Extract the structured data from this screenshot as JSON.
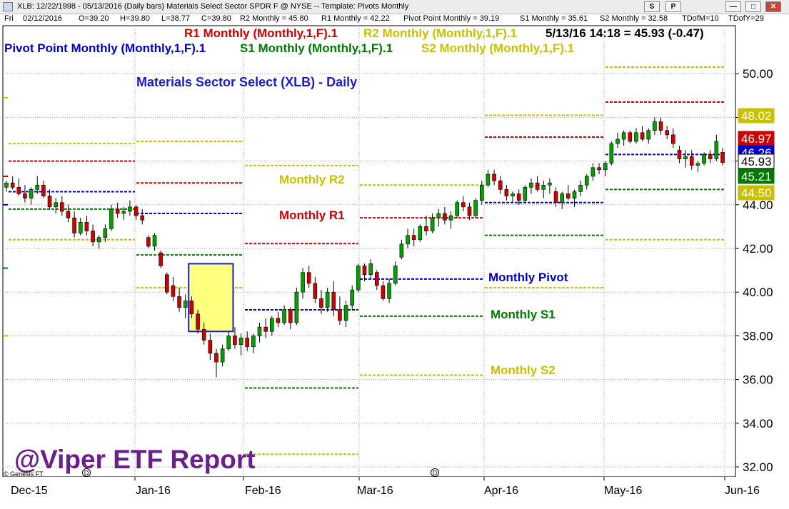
{
  "window": {
    "title": "XLB: 12/22/1998 - 05/13/2016  (Daily bars)   Materials Select Sector SPDR F @ NYSE  --  Template: Pivots Monthly",
    "buttons": {
      "s": "S",
      "p": "P",
      "minimize": "—",
      "maximize": "□",
      "close": "✕"
    }
  },
  "info_bar": {
    "day": "Fri",
    "date": "02/12/2016",
    "open": "O=39.20",
    "high": "H=39.80",
    "low": "L=38.77",
    "close": "C=39.80",
    "r2": "R2 Monthly = 45.80",
    "r1": "R1 Monthly = 42.22",
    "pp": "Pivot Point Monthly = 39.19",
    "s1": "S1 Monthly = 35.61",
    "s2": "S2 Monthly = 32.58",
    "tdom": "TDofM=10",
    "tdoy": "TDofY=29"
  },
  "chart_data": {
    "type": "candlestick",
    "title": "Materials Sector Select (XLB) - Daily",
    "last_quote": "5/13/16 14:18 = 45.93 (-0.47)",
    "watermark": "@Viper ETF Report",
    "copyright": "© Genesis FT",
    "ylim": [
      31.5,
      52.0
    ],
    "y_ticks": [
      32,
      34,
      36,
      38,
      40,
      42,
      44,
      46,
      48,
      50
    ],
    "y_tick_labels": [
      "32.00",
      "34.00",
      "36.00",
      "38.00",
      "40.00",
      "42.00",
      "44.00",
      "46.00",
      "48.00",
      "50.00"
    ],
    "x_ticks": [
      "Dec-15",
      "Jan-16",
      "Feb-16",
      "Mar-16",
      "Apr-16",
      "May-16",
      "Jun-16"
    ],
    "legend": [
      {
        "text": "R1 Monthly (Monthly,1,F).1",
        "color": "#cc0000"
      },
      {
        "text": "R2 Monthly (Monthly,1,F).1",
        "color": "#c8c000"
      },
      {
        "text": "Pivot Point Monthly (Monthly,1,F).1",
        "color": "#0000cc"
      },
      {
        "text": "S1 Monthly (Monthly,1,F).1",
        "color": "#007a00"
      },
      {
        "text": "S2 Monthly (Monthly,1,F).1",
        "color": "#c8c000"
      }
    ],
    "pivot_levels": [
      {
        "month": "Dec-15",
        "r2": 46.8,
        "r1": 46.0,
        "pp": 44.6,
        "s1": 43.8,
        "s2": 42.4
      },
      {
        "month": "Jan-16",
        "r2": 46.9,
        "r1": 45.0,
        "pp": 43.6,
        "s1": 41.7,
        "s2": 40.2
      },
      {
        "month": "Feb-16",
        "r2": 45.8,
        "r1": 42.22,
        "pp": 39.19,
        "s1": 35.61,
        "s2": 32.58
      },
      {
        "month": "Mar-16",
        "r2": 44.9,
        "r1": 43.4,
        "pp": 40.6,
        "s1": 38.9,
        "s2": 36.2
      },
      {
        "month": "Apr-16",
        "r2": 48.1,
        "r1": 47.1,
        "pp": 44.1,
        "s1": 42.6,
        "s2": 40.2
      },
      {
        "month": "May-16",
        "r2": 50.3,
        "r1": 48.7,
        "pp": 46.3,
        "s1": 44.7,
        "s2": 42.4
      }
    ],
    "annotations": [
      {
        "text": "Monthly R2",
        "color": "#c8c000"
      },
      {
        "text": "Monthly R1",
        "color": "#cc0000"
      },
      {
        "text": "Monthly Pivot",
        "color": "#0000cc"
      },
      {
        "text": "Monthly S1",
        "color": "#007a00"
      },
      {
        "text": "Monthly S2",
        "color": "#c8c000"
      }
    ],
    "price_tags": [
      {
        "text": "48.02",
        "value": 48.02,
        "bg": "#c8c000",
        "fg": "#ffffff"
      },
      {
        "text": "46.97",
        "value": 46.97,
        "bg": "#cc0000",
        "fg": "#ffffff"
      },
      {
        "text": "46.26",
        "value": 46.26,
        "bg": "#0000cc",
        "fg": "#ffffff"
      },
      {
        "text": "45.93",
        "value": 45.93,
        "bg": "#ffffff",
        "fg": "#000000"
      },
      {
        "text": "45.21",
        "value": 45.21,
        "bg": "#007a00",
        "fg": "#ffffff"
      },
      {
        "text": "44.50",
        "value": 44.5,
        "bg": "#c8c000",
        "fg": "#ffffff"
      }
    ],
    "highlight_range": {
      "from_bar": 38,
      "to_bar": 45,
      "low": 38.2,
      "high": 41.3
    },
    "candles": [
      [
        44.8,
        45.1,
        44.6,
        45.0
      ],
      [
        45.0,
        45.3,
        44.7,
        44.8
      ],
      [
        44.8,
        45.2,
        44.4,
        44.5
      ],
      [
        44.5,
        44.9,
        44.1,
        44.3
      ],
      [
        44.3,
        44.8,
        44.0,
        44.7
      ],
      [
        44.7,
        45.3,
        44.5,
        44.9
      ],
      [
        44.9,
        45.1,
        44.3,
        44.4
      ],
      [
        44.4,
        44.7,
        43.8,
        43.9
      ],
      [
        43.9,
        44.3,
        43.6,
        44.1
      ],
      [
        44.1,
        44.4,
        43.5,
        43.7
      ],
      [
        43.7,
        44.0,
        43.2,
        43.4
      ],
      [
        43.4,
        43.7,
        42.5,
        42.7
      ],
      [
        42.7,
        43.4,
        42.6,
        43.2
      ],
      [
        43.2,
        43.5,
        42.6,
        42.8
      ],
      [
        42.8,
        43.1,
        42.1,
        42.3
      ],
      [
        42.3,
        42.6,
        42.0,
        42.5
      ],
      [
        42.5,
        43.1,
        42.3,
        42.9
      ],
      [
        42.9,
        44.0,
        42.8,
        43.8
      ],
      [
        43.8,
        44.1,
        43.4,
        43.6
      ],
      [
        43.6,
        43.9,
        43.3,
        43.7
      ],
      [
        43.7,
        44.2,
        43.5,
        43.9
      ],
      [
        43.9,
        44.0,
        43.3,
        43.5
      ],
      [
        43.5,
        43.8,
        43.1,
        43.3
      ],
      [
        42.5,
        42.6,
        42.0,
        42.1
      ],
      [
        42.1,
        42.7,
        41.9,
        42.6
      ],
      [
        41.8,
        41.9,
        41.1,
        41.2
      ],
      [
        40.8,
        40.9,
        39.9,
        40.0
      ],
      [
        40.3,
        40.7,
        39.6,
        39.8
      ],
      [
        39.8,
        40.2,
        39.1,
        39.3
      ],
      [
        39.3,
        39.9,
        38.8,
        39.6
      ],
      [
        39.6,
        39.8,
        38.8,
        39.0
      ],
      [
        39.0,
        39.2,
        38.1,
        38.3
      ],
      [
        38.3,
        38.6,
        37.6,
        37.8
      ],
      [
        37.8,
        38.1,
        36.9,
        37.2
      ],
      [
        37.2,
        37.4,
        36.1,
        36.8
      ],
      [
        36.8,
        37.6,
        36.6,
        37.4
      ],
      [
        37.4,
        38.2,
        37.3,
        38.0
      ],
      [
        38.0,
        38.4,
        37.4,
        37.6
      ],
      [
        37.6,
        38.1,
        37.1,
        37.9
      ],
      [
        37.9,
        38.2,
        37.3,
        37.5
      ],
      [
        37.5,
        38.1,
        37.2,
        38.0
      ],
      [
        38.0,
        38.6,
        37.7,
        38.4
      ],
      [
        38.4,
        38.8,
        37.9,
        38.2
      ],
      [
        38.2,
        38.9,
        38.0,
        38.8
      ],
      [
        38.8,
        39.1,
        38.4,
        38.6
      ],
      [
        38.6,
        39.4,
        38.5,
        39.2
      ],
      [
        39.2,
        39.3,
        38.3,
        38.6
      ],
      [
        38.6,
        40.2,
        38.5,
        40.0
      ],
      [
        40.0,
        41.1,
        39.7,
        40.9
      ],
      [
        40.9,
        41.2,
        40.2,
        40.4
      ],
      [
        40.4,
        40.7,
        39.5,
        39.7
      ],
      [
        39.7,
        40.1,
        39.0,
        39.3
      ],
      [
        39.3,
        40.2,
        39.1,
        40.0
      ],
      [
        40.0,
        40.5,
        38.9,
        39.2
      ],
      [
        39.2,
        39.8,
        38.5,
        38.7
      ],
      [
        38.7,
        39.6,
        38.4,
        39.4
      ],
      [
        39.4,
        40.3,
        39.2,
        40.1
      ],
      [
        40.1,
        41.3,
        40.0,
        41.2
      ],
      [
        41.2,
        41.3,
        40.5,
        40.8
      ],
      [
        40.8,
        41.5,
        40.6,
        41.3
      ],
      [
        40.9,
        41.0,
        40.1,
        40.3
      ],
      [
        40.3,
        40.5,
        39.6,
        39.7
      ],
      [
        39.7,
        40.6,
        39.5,
        40.4
      ],
      [
        40.4,
        41.4,
        40.3,
        41.2
      ],
      [
        41.6,
        42.4,
        41.5,
        42.2
      ],
      [
        42.2,
        42.9,
        42.0,
        42.6
      ],
      [
        42.6,
        42.9,
        42.1,
        42.4
      ],
      [
        42.4,
        43.1,
        42.3,
        43.0
      ],
      [
        43.0,
        43.5,
        42.6,
        42.8
      ],
      [
        42.8,
        43.6,
        42.7,
        43.4
      ],
      [
        43.4,
        43.8,
        43.0,
        43.6
      ],
      [
        43.6,
        43.9,
        43.1,
        43.3
      ],
      [
        43.3,
        43.7,
        42.9,
        43.5
      ],
      [
        43.5,
        44.2,
        43.4,
        44.1
      ],
      [
        44.1,
        44.4,
        43.7,
        43.9
      ],
      [
        43.9,
        44.1,
        43.3,
        43.5
      ],
      [
        43.5,
        44.3,
        43.4,
        44.2
      ],
      [
        44.2,
        45.1,
        44.0,
        44.9
      ],
      [
        44.9,
        45.6,
        44.8,
        45.4
      ],
      [
        45.4,
        45.6,
        44.9,
        45.1
      ],
      [
        45.1,
        45.3,
        44.5,
        44.7
      ],
      [
        44.7,
        44.9,
        44.2,
        44.4
      ],
      [
        44.4,
        44.6,
        44.1,
        44.5
      ],
      [
        44.5,
        44.7,
        44.0,
        44.2
      ],
      [
        44.2,
        44.9,
        44.1,
        44.8
      ],
      [
        44.8,
        45.2,
        44.5,
        45.0
      ],
      [
        45.0,
        45.3,
        44.6,
        44.7
      ],
      [
        44.7,
        45.1,
        44.3,
        44.9
      ],
      [
        44.9,
        45.2,
        44.5,
        45.0
      ],
      [
        44.6,
        44.8,
        43.9,
        44.1
      ],
      [
        44.1,
        44.6,
        43.8,
        44.5
      ],
      [
        44.5,
        44.9,
        44.2,
        44.3
      ],
      [
        44.3,
        44.7,
        43.9,
        44.6
      ],
      [
        44.6,
        45.1,
        44.4,
        44.9
      ],
      [
        44.9,
        45.4,
        44.7,
        45.3
      ],
      [
        45.3,
        45.9,
        45.1,
        45.7
      ],
      [
        45.7,
        45.9,
        45.4,
        45.6
      ],
      [
        45.6,
        46.0,
        45.3,
        45.9
      ],
      [
        45.9,
        46.9,
        45.8,
        46.8
      ],
      [
        46.8,
        47.3,
        46.6,
        47.0
      ],
      [
        47.0,
        47.4,
        46.7,
        47.3
      ],
      [
        47.3,
        47.4,
        46.8,
        46.9
      ],
      [
        46.9,
        47.5,
        46.8,
        47.3
      ],
      [
        47.3,
        47.6,
        46.9,
        47.0
      ],
      [
        47.0,
        47.5,
        46.8,
        47.4
      ],
      [
        47.4,
        48.0,
        47.2,
        47.8
      ],
      [
        47.8,
        48.0,
        47.2,
        47.4
      ],
      [
        47.4,
        47.6,
        47.0,
        47.2
      ],
      [
        47.2,
        47.5,
        46.6,
        46.8
      ],
      [
        46.5,
        46.7,
        45.9,
        46.1
      ],
      [
        46.1,
        46.5,
        45.7,
        46.2
      ],
      [
        46.2,
        46.5,
        45.6,
        45.8
      ],
      [
        45.8,
        46.0,
        45.5,
        45.9
      ],
      [
        45.9,
        46.4,
        45.8,
        46.3
      ],
      [
        46.3,
        46.5,
        45.9,
        46.1
      ],
      [
        46.1,
        47.2,
        46.0,
        46.9
      ],
      [
        46.4,
        46.6,
        45.8,
        45.93
      ]
    ]
  }
}
